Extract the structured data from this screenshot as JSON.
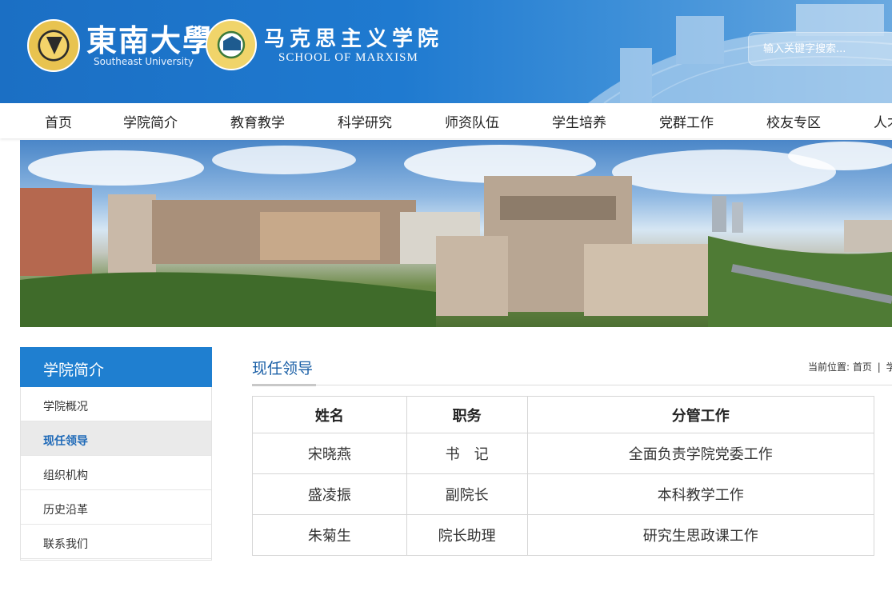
{
  "header": {
    "university_cn": "東南大學",
    "university_en": "Southeast University",
    "school_cn": "马克思主义学院",
    "school_en": "SCHOOL OF MARXISM",
    "search_placeholder": "输入关键字搜索..."
  },
  "nav": {
    "items": [
      "首页",
      "学院简介",
      "教育教学",
      "科学研究",
      "师资队伍",
      "学生培养",
      "党群工作",
      "校友专区",
      "人才"
    ]
  },
  "sidebar": {
    "title": "学院简介",
    "items": [
      {
        "label": "学院概况"
      },
      {
        "label": "现任领导",
        "active": true
      },
      {
        "label": "组织机构"
      },
      {
        "label": "历史沿革"
      },
      {
        "label": "联系我们"
      }
    ]
  },
  "content": {
    "title": "现任领导",
    "breadcrumb": {
      "prefix": "当前位置:",
      "home": "首页",
      "sep": "|",
      "current": "学"
    },
    "table": {
      "headers": [
        "姓名",
        "职务",
        "分管工作"
      ],
      "rows": [
        [
          "宋晓燕",
          "书　记",
          "全面负责学院党委工作"
        ],
        [
          "盛凌振",
          "副院长",
          "本科教学工作"
        ],
        [
          "朱菊生",
          "院长助理",
          "研究生思政课工作"
        ]
      ]
    }
  },
  "colors": {
    "header_blue": "#1b6fc4",
    "accent_blue": "#1f7fd0",
    "title_blue": "#1a5fa6"
  }
}
